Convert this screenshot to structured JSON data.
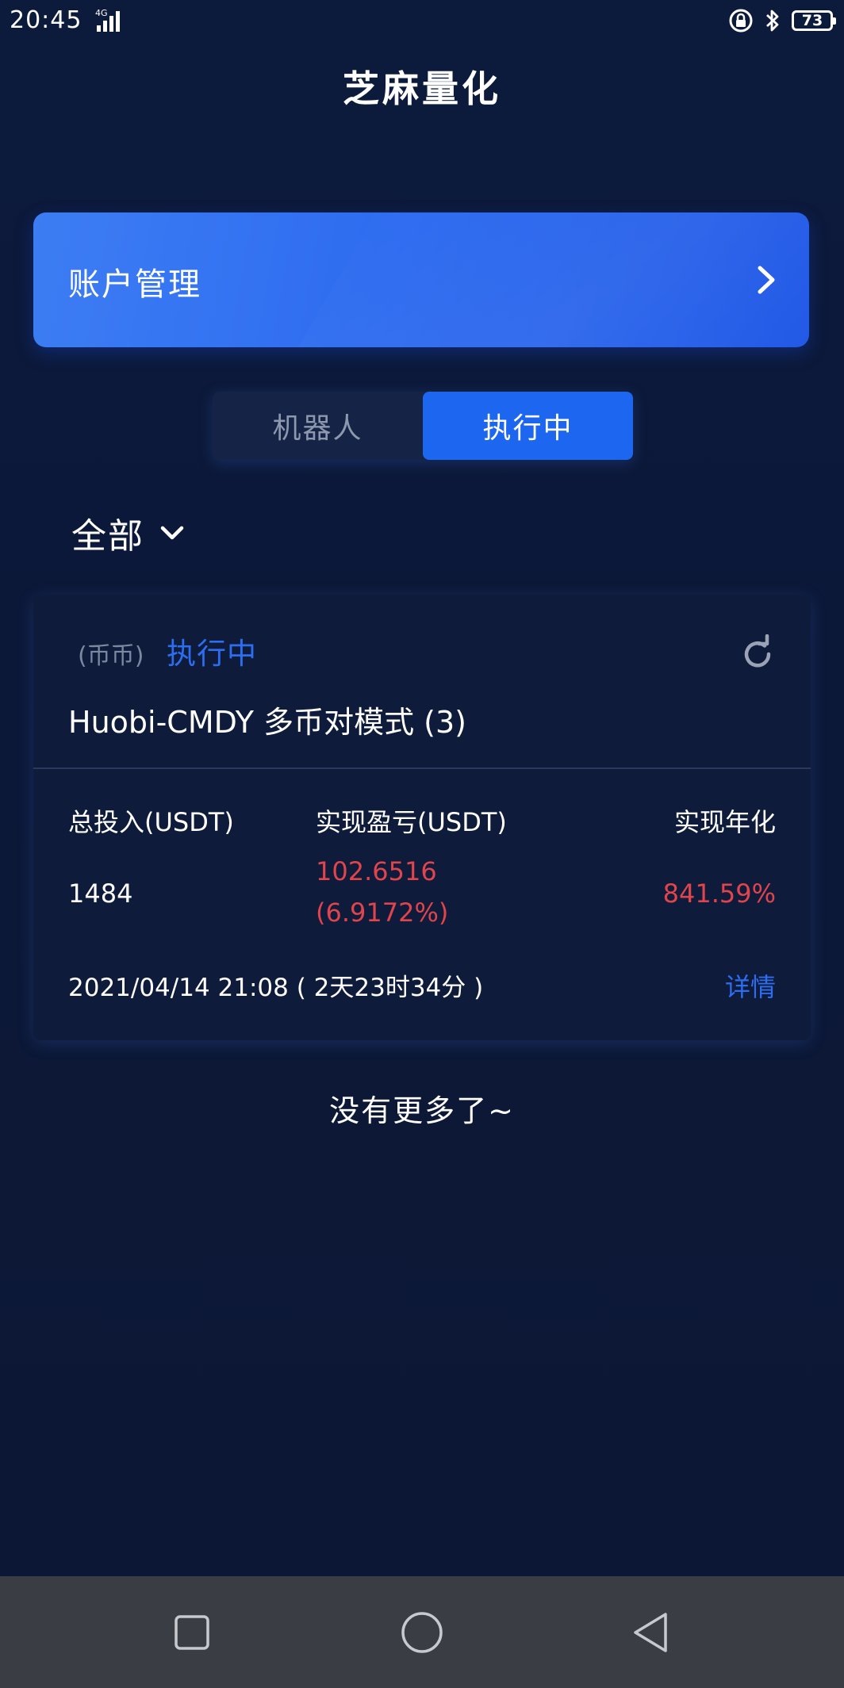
{
  "status_bar": {
    "time": "20:45",
    "network": "4G",
    "battery": "73"
  },
  "header": {
    "title": "芝麻量化"
  },
  "account": {
    "label": "账户管理"
  },
  "tabs": [
    {
      "label": "机器人",
      "active": false
    },
    {
      "label": "执行中",
      "active": true
    }
  ],
  "filter": {
    "label": "全部"
  },
  "card": {
    "type": "(币币)",
    "status": "执行中",
    "name": "Huobi-CMDY 多币对模式 (3)",
    "stats": {
      "investment_label": "总投入(USDT)",
      "investment_value": "1484",
      "pnl_label": "实现盈亏(USDT)",
      "pnl_value": "102.6516",
      "pnl_percent": "(6.9172%)",
      "annual_label": "实现年化",
      "annual_value": "841.59%"
    },
    "time": "2021/04/14 21:08 ( 2天23时34分 )",
    "detail_label": "详情"
  },
  "footer_text": "没有更多了~",
  "colors": {
    "background": "#0c1838",
    "accent_blue": "#1c66f0",
    "profit_red": "#e0444c",
    "nav_bar": "#3b3d45"
  },
  "icons": {
    "account_arrow": "chevron-right-icon",
    "filter_arrow": "chevron-down-icon",
    "refresh": "refresh-icon",
    "nav": [
      "recent-apps-icon",
      "home-icon",
      "back-icon"
    ]
  }
}
